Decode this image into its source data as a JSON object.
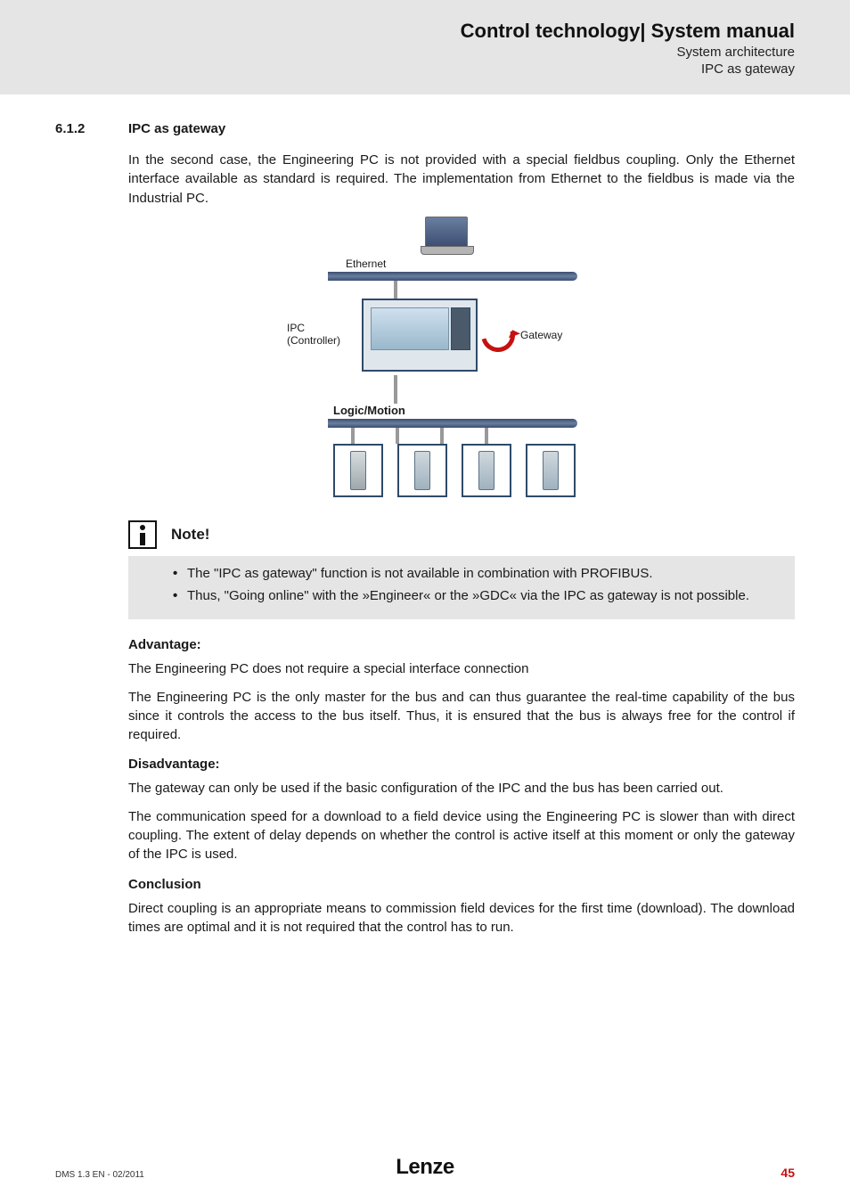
{
  "header": {
    "title": "Control technology| System manual",
    "sub1": "System architecture",
    "sub2": "IPC as gateway"
  },
  "section": {
    "number": "6.1.2",
    "title": "IPC as gateway"
  },
  "intro": "In the second case, the Engineering PC is not provided with a special fieldbus coupling. Only the Ethernet interface available as standard is required. The implementation from Ethernet to the fieldbus is made via the Industrial PC.",
  "figure": {
    "ethernet": "Ethernet",
    "ipc_line1": "IPC",
    "ipc_line2": "(Controller)",
    "gateway": "Gateway",
    "logicmotion": "Logic/Motion"
  },
  "note": {
    "title": "Note!",
    "bullet1": "The \"IPC as gateway\" function is not available in combination with PROFIBUS.",
    "bullet2": "Thus, \"Going online\" with the »Engineer« or the »GDC« via the IPC as gateway is not possible."
  },
  "advantage": {
    "heading": "Advantage:",
    "p1": "The Engineering PC does not require a special interface connection",
    "p2": "The Engineering PC is the only master for the bus and can thus guarantee the real-time capability of the bus since it controls the access to the bus itself. Thus, it is ensured that the bus is always free for the control if required."
  },
  "disadvantage": {
    "heading": "Disadvantage:",
    "p1": "The gateway can only be used if the basic configuration of the IPC and the bus has been carried out.",
    "p2": "The communication speed for a download to a field device using the Engineering PC is slower than with direct coupling. The extent of delay depends on whether the control is active itself at this moment or only the gateway of the IPC is used."
  },
  "conclusion": {
    "heading": "Conclusion",
    "p1": "Direct coupling is an appropriate means to commission field devices for the first time (download). The download times are optimal and it is not required that the control has to run."
  },
  "footer": {
    "left": "DMS 1.3 EN - 02/2011",
    "center": "Lenze",
    "right": "45"
  }
}
